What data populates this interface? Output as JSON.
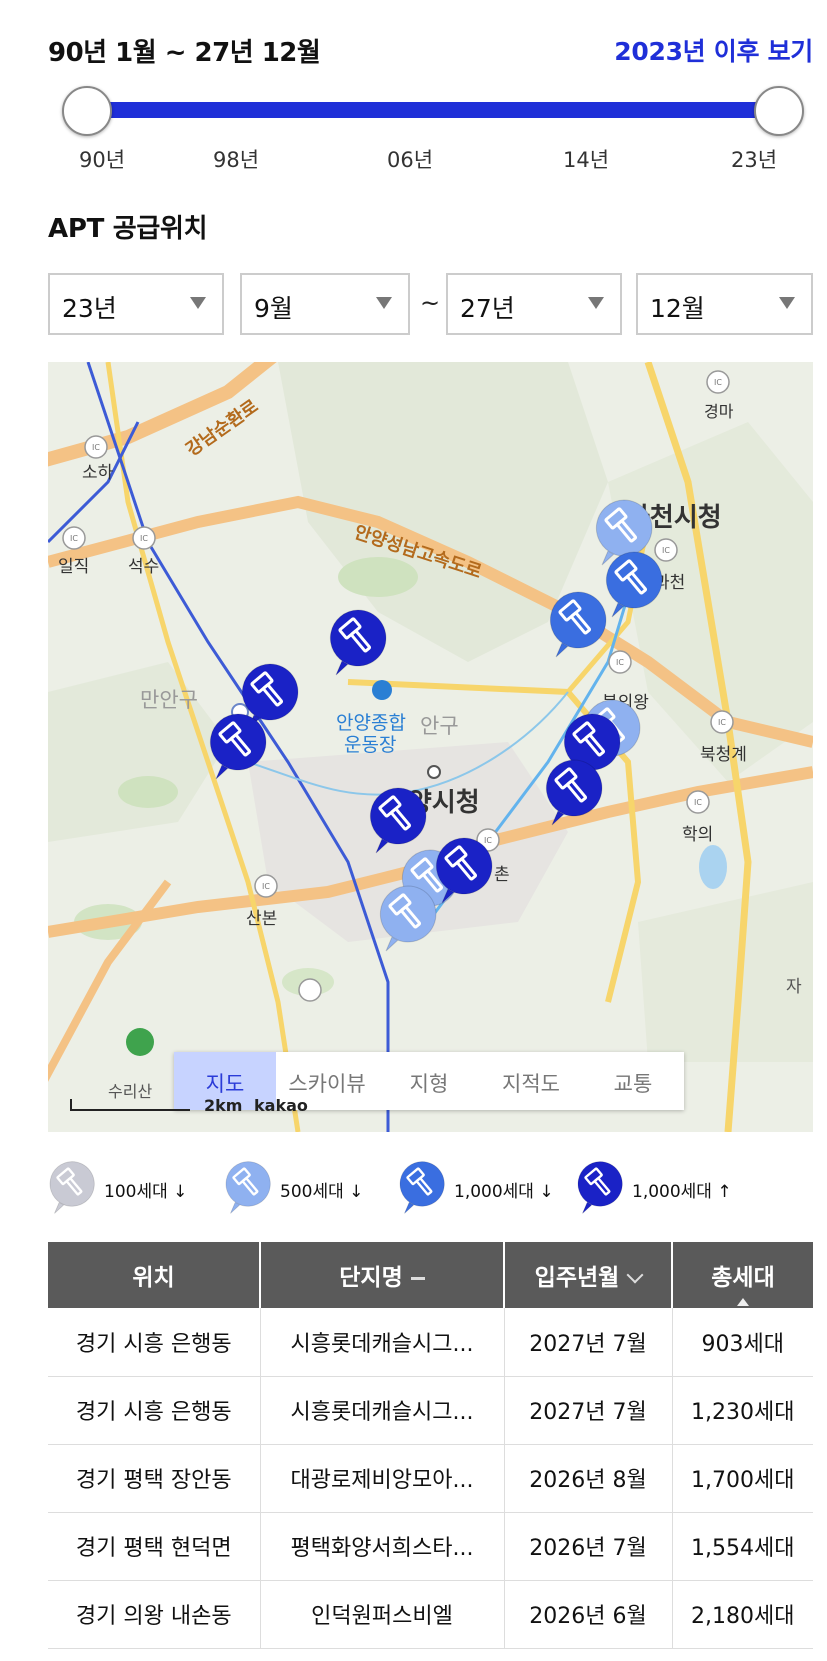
{
  "period": {
    "range_text": "90년 1월 ~ 27년 12월",
    "after_link": "2023년 이후 보기",
    "ticks": [
      "90년",
      "98년",
      "06년",
      "14년",
      "23년"
    ]
  },
  "section_title": "APT 공급위치",
  "filters": {
    "from_year": "23년",
    "from_month": "9월",
    "separator": "~",
    "to_year": "27년",
    "to_month": "12월"
  },
  "map": {
    "labels": {
      "gangnam_ring": "강남순환로",
      "anyang_highway": "안양성남고속도로",
      "gwacheon_hall": "과천시청",
      "anyang_hall": "안양시청",
      "manan": "만안구",
      "dongan": "안구",
      "stadium_1": "안양종합",
      "stadium_2": "운동장",
      "soha": "소하",
      "ilgik": "일직",
      "seoksu": "석수",
      "gyeongma": "경마",
      "bugeuiwang": "북의왕",
      "bukcheonggye": "북청계",
      "hakui": "학의",
      "sanbon": "산본",
      "gwacheon_ic": "과천",
      "beomgye": "촌",
      "suriisan": "수리산",
      "ja": "자",
      "ic": "IC"
    },
    "tabs": [
      "지도",
      "스카이뷰",
      "지형",
      "지적도",
      "교통"
    ],
    "active_tab": "지도",
    "scale": "2km",
    "provider": "kakao"
  },
  "legend": [
    {
      "label": "100세대 ↓",
      "color": "#c9cad4"
    },
    {
      "label": "500세대 ↓",
      "color": "#8fb1f0"
    },
    {
      "label": "1,000세대 ↓",
      "color": "#3a6ee0"
    },
    {
      "label": "1,000세대 ↑",
      "color": "#1a22c6"
    }
  ],
  "table": {
    "headers": [
      "위치",
      "단지명",
      "입주년월",
      "총세대"
    ],
    "rows": [
      [
        "경기 시흥 은행동",
        "시흥롯데캐슬시그...",
        "2027년 7월",
        "903세대"
      ],
      [
        "경기 시흥 은행동",
        "시흥롯데캐슬시그...",
        "2027년 7월",
        "1,230세대"
      ],
      [
        "경기 평택 장안동",
        "대광로제비앙모아...",
        "2026년 8월",
        "1,700세대"
      ],
      [
        "경기 평택 현덕면",
        "평택화양서희스타...",
        "2026년 7월",
        "1,554세대"
      ],
      [
        "경기 의왕 내손동",
        "인덕원퍼스비엘",
        "2026년 6월",
        "2,180세대"
      ]
    ]
  }
}
